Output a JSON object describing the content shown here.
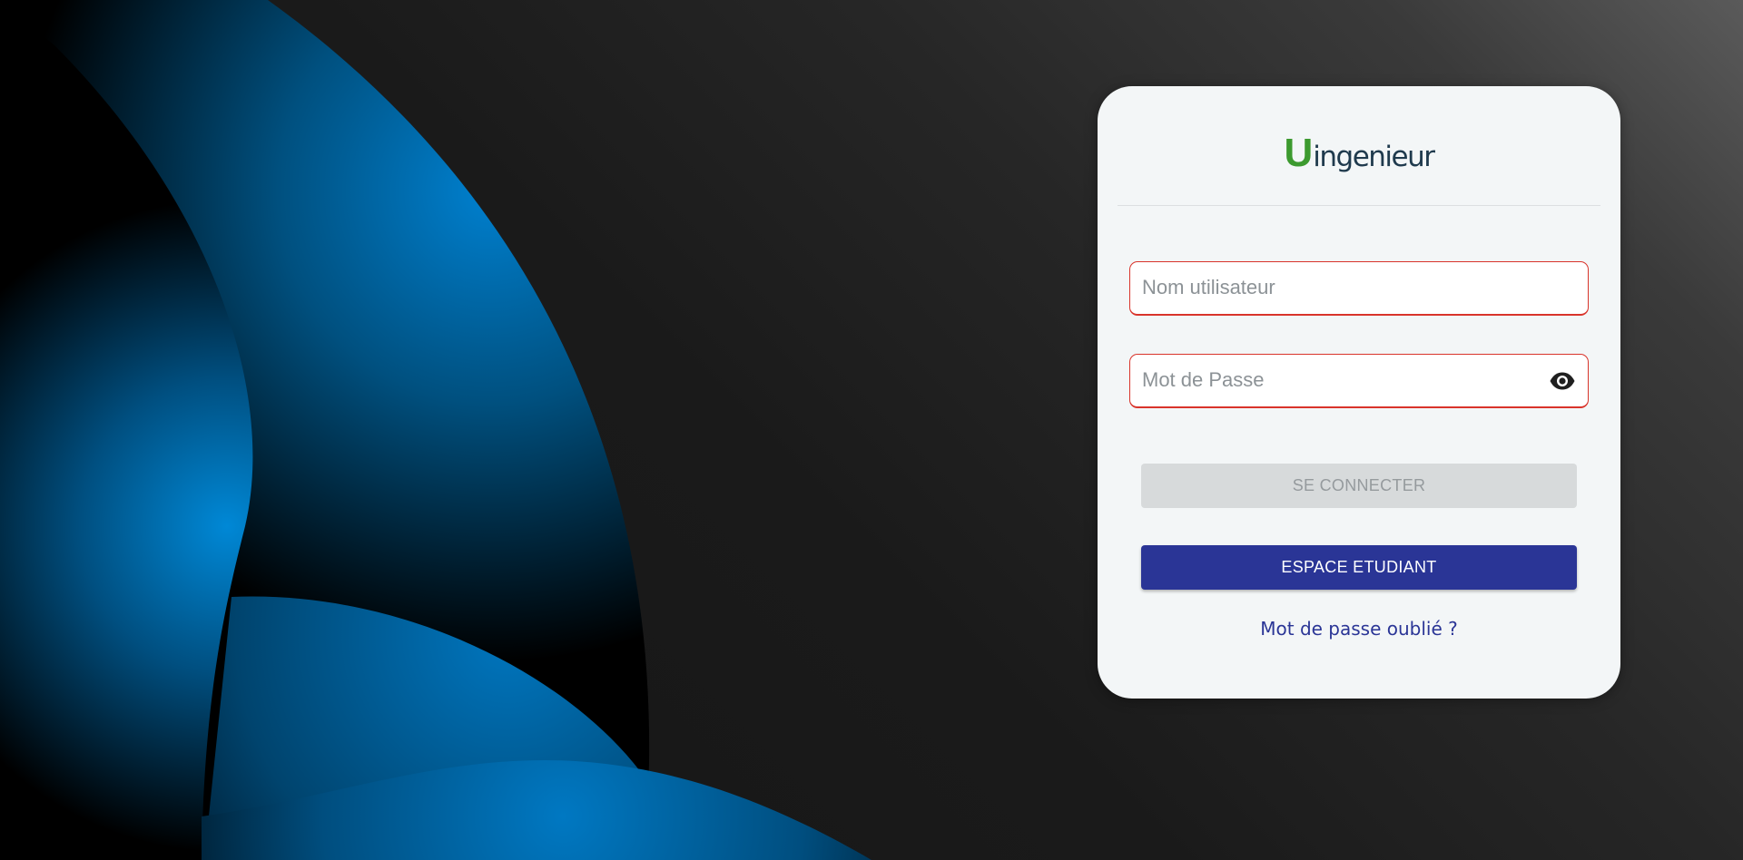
{
  "brand": {
    "logo_letter": "U",
    "logo_word": "ingenieur",
    "logo_letter_color": "#3c9a2f",
    "logo_word_color": "#1f3a4d"
  },
  "login": {
    "username_placeholder": "Nom utilisateur",
    "username_value": "",
    "password_placeholder": "Mot de Passe",
    "password_value": "",
    "password_toggle_icon": "eye-icon",
    "connect_label": "SE CONNECTER",
    "student_space_label": "ESPACE ETUDIANT",
    "forgot_password_label": "Mot de passe oublié ?"
  },
  "colors": {
    "primary": "#2a3596",
    "field_error_border": "#d9342b",
    "card_background": "#f3f6f7",
    "disabled_button": "#d7dadb",
    "background_art_blue": "#0078c2"
  }
}
